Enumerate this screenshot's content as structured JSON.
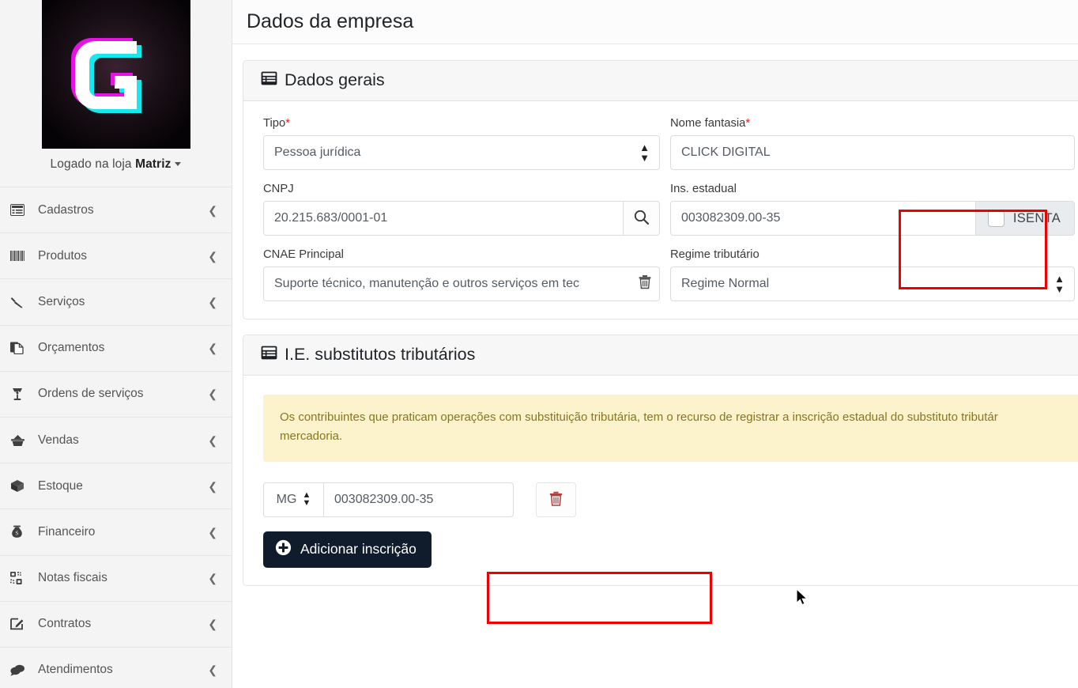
{
  "sidebar": {
    "store_prefix": "Logado na loja ",
    "store_name": "Matriz",
    "items": [
      {
        "label": "Cadastros",
        "icon": "list-box-icon"
      },
      {
        "label": "Produtos",
        "icon": "barcode-icon"
      },
      {
        "label": "Serviços",
        "icon": "screwdriver-icon"
      },
      {
        "label": "Orçamentos",
        "icon": "copy-files-icon"
      },
      {
        "label": "Ordens de serviços",
        "icon": "broken-glass-icon"
      },
      {
        "label": "Vendas",
        "icon": "basket-icon"
      },
      {
        "label": "Estoque",
        "icon": "box-icon"
      },
      {
        "label": "Financeiro",
        "icon": "money-bag-icon"
      },
      {
        "label": "Notas fiscais",
        "icon": "qr-code-icon"
      },
      {
        "label": "Contratos",
        "icon": "edit-square-icon"
      },
      {
        "label": "Atendimentos",
        "icon": "chat-bubbles-icon"
      }
    ]
  },
  "header": {
    "title": "Dados da empresa"
  },
  "general": {
    "card_title": "Dados gerais",
    "tipo_label": "Tipo",
    "tipo_value": "Pessoa jurídica",
    "nome_label": "Nome fantasia",
    "nome_value": "CLICK DIGITAL",
    "cnpj_label": "CNPJ",
    "cnpj_value": "20.215.683/0001-01",
    "cnpj_search_icon": "search-icon",
    "ie_label": "Ins. estadual",
    "ie_value": "003082309.00-35",
    "isenta_label": "ISENTA",
    "isenta_checked": false,
    "cnae_label": "CNAE Principal",
    "cnae_value": "Suporte técnico, manutenção e outros serviços em tec",
    "cnae_clear_icon": "trash-icon",
    "regime_label": "Regime tributário",
    "regime_value": "Regime Normal"
  },
  "substitutos": {
    "card_title": "I.E. substitutos tributários",
    "alert_line1": "Os contribuintes que praticam operações com substituição tributária, tem o recurso de registrar a inscrição estadual do substituto tributár",
    "alert_line2": "mercadoria.",
    "uf_value": "MG",
    "ie_value": "003082309.00-35",
    "delete_icon": "trash-icon",
    "add_label": "Adicionar inscrição",
    "add_icon": "plus-circle-icon"
  },
  "colors": {
    "accent_dark": "#101c2c",
    "annotation_red": "#ee0000",
    "alert_bg": "#fcf3cd",
    "alert_text": "#87761f",
    "required_red": "#e02020"
  }
}
